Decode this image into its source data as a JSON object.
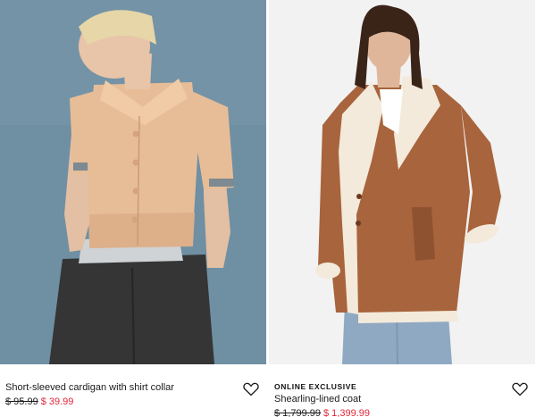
{
  "products": [
    {
      "eyebrow": "",
      "name": "Short-sleeved cardigan with shirt collar",
      "old_price": "$ 95.99",
      "sale_price": "$ 39.99",
      "favorite_icon": "heart-outline-icon",
      "image_subject": "model-in-beige-cardigan",
      "colors": {
        "background": "#6f8fa3",
        "garment": "#e7bd97",
        "trousers": "#353535"
      }
    },
    {
      "eyebrow": "ONLINE EXCLUSIVE",
      "name": "Shearling-lined coat",
      "old_price": "$ 1,799.99",
      "sale_price": "$ 1,399.99",
      "favorite_icon": "heart-outline-icon",
      "image_subject": "model-in-brown-shearling-coat",
      "colors": {
        "background": "#f2f2f2",
        "garment": "#a8643c",
        "lining": "#f3eadb"
      }
    }
  ],
  "sale_color": "#e0263a"
}
